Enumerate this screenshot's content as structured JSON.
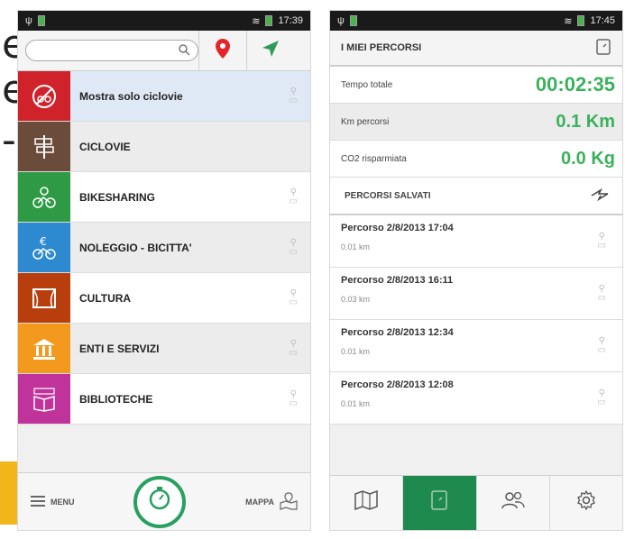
{
  "background": {
    "fragments": [
      "e",
      "e",
      "-"
    ]
  },
  "phone1": {
    "status": {
      "time": "17:39"
    },
    "search": {
      "placeholder": ""
    },
    "menu_items": [
      {
        "label": "Mostra solo ciclovie",
        "color": "#d0222a",
        "icon": "no-bike-icon"
      },
      {
        "label": "CICLOVIE",
        "color": "#6b4b3a",
        "icon": "signpost-icon"
      },
      {
        "label": "BIKESHARING",
        "color": "#2f9a45",
        "icon": "bikeshare-icon"
      },
      {
        "label": "NOLEGGIO - BICITTA'",
        "color": "#2d8ad0",
        "icon": "euro-bike-icon"
      },
      {
        "label": "CULTURA",
        "color": "#b83e0e",
        "icon": "theatre-icon"
      },
      {
        "label": "ENTI E SERVIZI",
        "color": "#f39a1e",
        "icon": "building-icon"
      },
      {
        "label": "BIBLIOTECHE",
        "color": "#c0339a",
        "icon": "book-icon"
      }
    ],
    "bottom": {
      "menu_label": "MENU",
      "map_label": "MAPPA"
    }
  },
  "phone2": {
    "status": {
      "time": "17:45"
    },
    "header": {
      "title": "I MIEI PERCORSI"
    },
    "stats": [
      {
        "label": "Tempo totale",
        "value": "00:02:35"
      },
      {
        "label": "Km percorsi",
        "value": "0.1 Km"
      },
      {
        "label": "CO2 risparmiata",
        "value": "0.0 Kg"
      }
    ],
    "saved_header": "PERCORSI SALVATI",
    "routes": [
      {
        "title": "Percorso 2/8/2013 17:04",
        "distance": "0.01 km"
      },
      {
        "title": "Percorso 2/8/2013 16:11",
        "distance": "0.03 km"
      },
      {
        "title": "Percorso 2/8/2013 12:34",
        "distance": "0.01 km"
      },
      {
        "title": "Percorso 2/8/2013 12:08",
        "distance": "0.01 km"
      }
    ]
  },
  "colors": {
    "accent_green": "#27a060",
    "value_green": "#3cb15c",
    "active_tab": "#1f8a4d",
    "pin_red": "#e3252b"
  }
}
